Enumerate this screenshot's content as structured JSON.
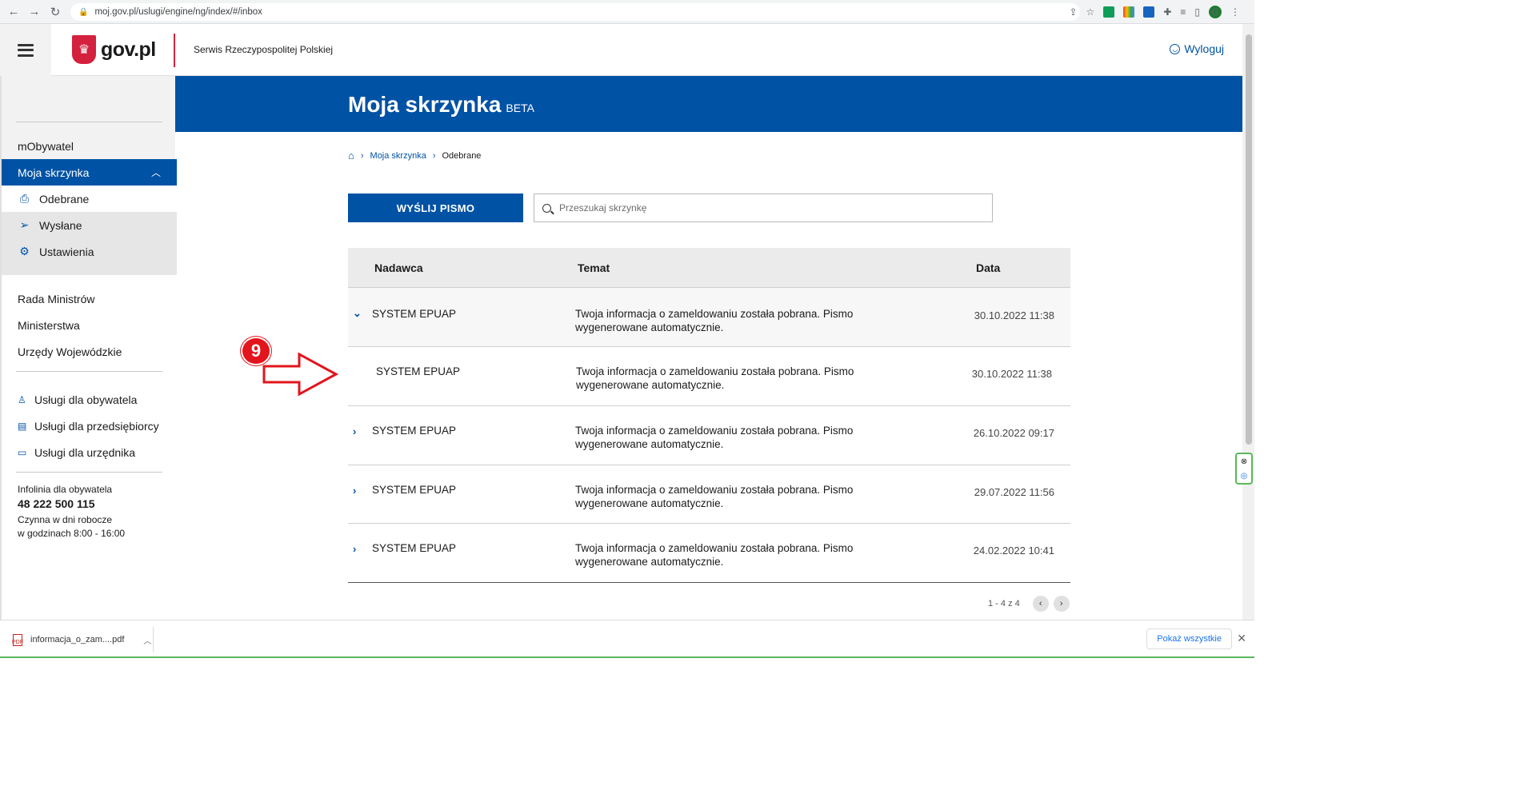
{
  "browser": {
    "url": "moj.gov.pl/uslugi/engine/ng/index/#/inbox"
  },
  "header": {
    "logo_text": "gov.pl",
    "service_name": "Serwis Rzeczypospolitej Polskiej",
    "logout_label": "Wyloguj"
  },
  "sidebar": {
    "mobywatel": "mObywatel",
    "active_section": "Moja skrzynka",
    "subitems": [
      "Odebrane",
      "Wysłane",
      "Ustawienia"
    ],
    "links": [
      "Rada Ministrów",
      "Ministerstwa",
      "Urzędy Wojewódzkie"
    ],
    "services": [
      "Usługi dla obywatela",
      "Usługi dla przedsiębiorcy",
      "Usługi dla urzędnika"
    ],
    "infolinia_label": "Infolinia dla obywatela",
    "phone": "48 222 500 115",
    "hours_line1": "Czynna w dni robocze",
    "hours_line2": "w godzinach 8:00 - 16:00"
  },
  "banner": {
    "title": "Moja skrzynka",
    "badge": "BETA"
  },
  "breadcrumb": {
    "parent": "Moja skrzynka",
    "current": "Odebrane"
  },
  "actions": {
    "send_label": "WYŚLIJ PISMO",
    "search_placeholder": "Przeszukaj skrzynkę"
  },
  "table": {
    "headers": {
      "sender": "Nadawca",
      "subject": "Temat",
      "date": "Data"
    },
    "rows": [
      {
        "sender": "SYSTEM EPUAP",
        "subject": "Twoja informacja o zameldowaniu została pobrana. Pismo wygenerowane automatycznie.",
        "date": "30.10.2022 11:38"
      },
      {
        "sender": "SYSTEM EPUAP",
        "subject": "Twoja informacja o zameldowaniu została pobrana. Pismo wygenerowane automatycznie.",
        "date": "30.10.2022 11:38"
      },
      {
        "sender": "SYSTEM EPUAP",
        "subject": "Twoja informacja o zameldowaniu została pobrana. Pismo wygenerowane automatycznie.",
        "date": "26.10.2022 09:17"
      },
      {
        "sender": "SYSTEM EPUAP",
        "subject": "Twoja informacja o zameldowaniu została pobrana. Pismo wygenerowane automatycznie.",
        "date": "29.07.2022 11:56"
      },
      {
        "sender": "SYSTEM EPUAP",
        "subject": "Twoja informacja o zameldowaniu została pobrana. Pismo wygenerowane automatycznie.",
        "date": "24.02.2022 10:41"
      }
    ]
  },
  "pagination": {
    "label": "1 - 4 z 4"
  },
  "annotation": {
    "step": "9"
  },
  "download_bar": {
    "filename": "informacja_o_zam....pdf",
    "show_all_label": "Pokaż wszystkie"
  },
  "colors": {
    "brand_blue": "#0052a5",
    "gov_red": "#d4213d",
    "annotation_red": "#e3141c"
  }
}
